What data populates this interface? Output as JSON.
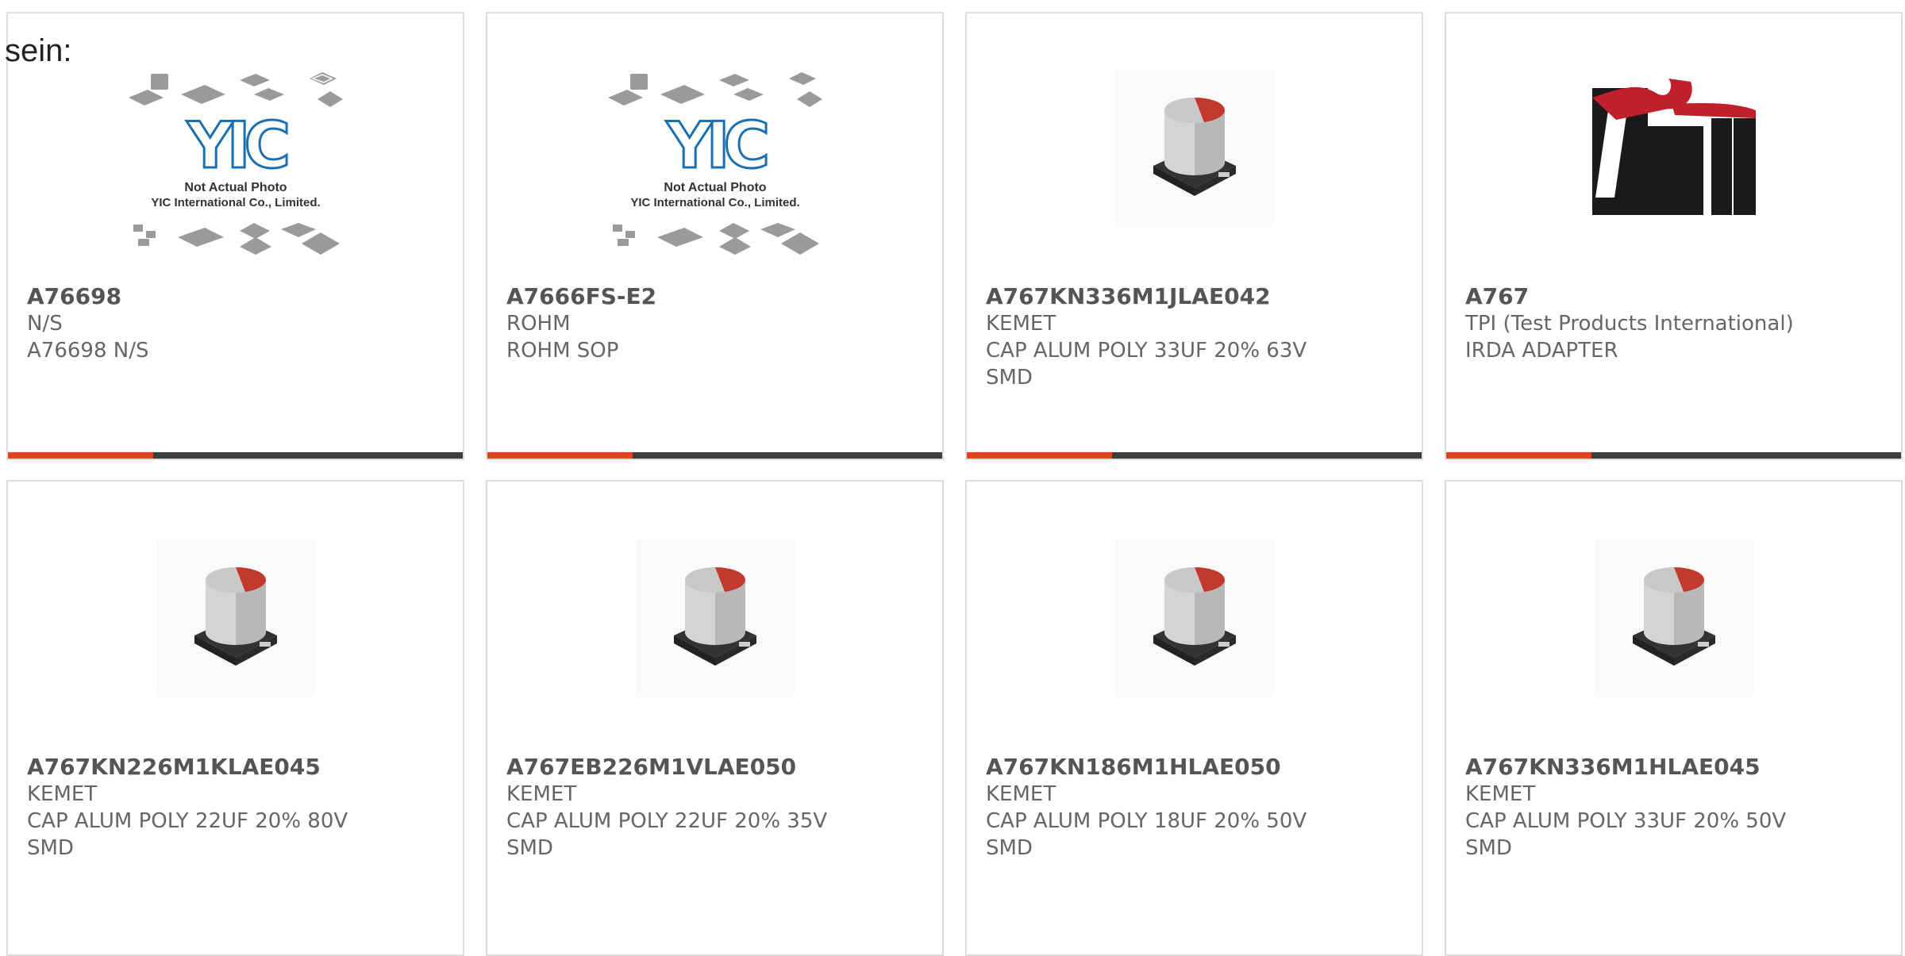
{
  "stray_text": "sein:",
  "colors": {
    "accent": "#e8401c",
    "bar": "#3d3d3d",
    "border": "#dddddd",
    "text": "#666666"
  },
  "cards": [
    {
      "part_number": "A76698",
      "manufacturer": "N/S",
      "description": "A76698 N/S",
      "description2": "",
      "image": "yic-placeholder",
      "placeholder_caption1": "Not Actual Photo",
      "placeholder_caption2": "YIC International Co., Limited.",
      "placeholder_logo": "YIC"
    },
    {
      "part_number": "A7666FS-E2",
      "manufacturer": "ROHM",
      "description": "ROHM SOP",
      "description2": "",
      "image": "yic-placeholder",
      "placeholder_caption1": "Not Actual Photo",
      "placeholder_caption2": "YIC International Co., Limited.",
      "placeholder_logo": "YIC"
    },
    {
      "part_number": "A767KN336M1JLAE042",
      "manufacturer": "KEMET",
      "description": "CAP ALUM POLY 33UF 20% 63V",
      "description2": "SMD",
      "image": "smd-capacitor"
    },
    {
      "part_number": "A767",
      "manufacturer": "TPI (Test Products International)",
      "description": "IRDA ADAPTER",
      "description2": "",
      "image": "tpi-logo",
      "logo_text": "tpi"
    },
    {
      "part_number": "A767KN226M1KLAE045",
      "manufacturer": "KEMET",
      "description": "CAP ALUM POLY 22UF 20% 80V",
      "description2": "SMD",
      "image": "smd-capacitor"
    },
    {
      "part_number": "A767EB226M1VLAE050",
      "manufacturer": "KEMET",
      "description": "CAP ALUM POLY 22UF 20% 35V",
      "description2": "SMD",
      "image": "smd-capacitor"
    },
    {
      "part_number": "A767KN186M1HLAE050",
      "manufacturer": "KEMET",
      "description": "CAP ALUM POLY 18UF 20% 50V",
      "description2": "SMD",
      "image": "smd-capacitor"
    },
    {
      "part_number": "A767KN336M1HLAE045",
      "manufacturer": "KEMET",
      "description": "CAP ALUM POLY 33UF 20% 50V",
      "description2": "SMD",
      "image": "smd-capacitor"
    }
  ]
}
